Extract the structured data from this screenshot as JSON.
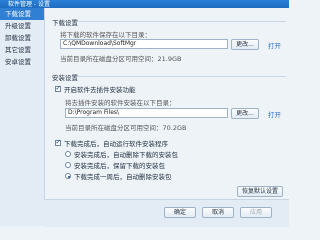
{
  "window": {
    "title": "软件管理 - 设置"
  },
  "sidebar": {
    "items": [
      {
        "label": "下载设置"
      },
      {
        "label": "升级设置"
      },
      {
        "label": "卸载设置"
      },
      {
        "label": "其它设置"
      },
      {
        "label": "安卓设置"
      }
    ]
  },
  "download": {
    "section_title": "下载设置",
    "desc": "将下载的软件保存在以下目录：",
    "path": "C:\\QMDownload\\SoftMgr",
    "browse_label": "更改...",
    "open_label": "打开",
    "space": "当前目录所在磁盘分区可用空间：21.9GB"
  },
  "install": {
    "section_title": "安装设置",
    "enable_label": "开启软件去插件安装功能",
    "desc": "将去插件安装的软件安装在以下目录：",
    "path": "D:\\Program Files\\",
    "browse_label": "更改...",
    "open_label": "打开",
    "space": "当前目录所在磁盘分区可用空间：70.2GB",
    "after_label": "下载完成后，自动运行软件安装程序",
    "options": [
      {
        "label": "安装完成后，自动删除下载的安装包"
      },
      {
        "label": "安装完成后，保留下载的安装包"
      },
      {
        "label": "下载完成一周后，自动删除安装包"
      }
    ],
    "restore_label": "恢复默认设置"
  },
  "footer": {
    "ok_label": "确定",
    "cancel_label": "取消",
    "apply_label": "应用"
  }
}
